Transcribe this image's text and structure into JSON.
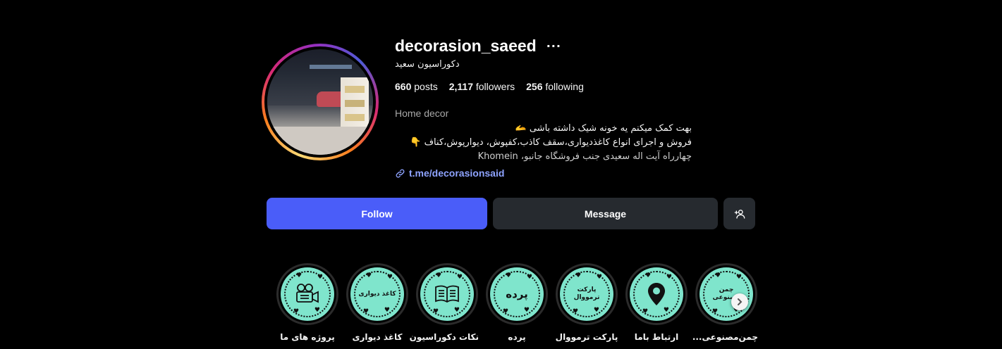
{
  "profile": {
    "username": "decorasion_saeed",
    "more_label": "···",
    "full_name": "دکوراسیون سعید",
    "stats": {
      "posts_count": "660",
      "posts_label": "posts",
      "followers_count": "2,117",
      "followers_label": "followers",
      "following_count": "256",
      "following_label": "following"
    },
    "category": "Home decor",
    "bio_line_1": "بهت کمک میکنم یه خونه شیک داشته باشی 🫴",
    "bio_line_2": "فروش و اجرای انواع کاغذدیواری،سقف کاذب،کفپوش، دیوارپوش،کناف 👇",
    "address": "چهارراه آیت اله سعیدی جنب فروشگاه جانبو، Khomein",
    "link": "t.me/decorasionsaid"
  },
  "actions": {
    "follow_label": "Follow",
    "message_label": "Message",
    "add_user_icon": "person-plus-icon"
  },
  "highlights": [
    {
      "label": "پروژه های ما",
      "cover_icon": "movie-camera-icon",
      "cover_text": ""
    },
    {
      "label": "کاغذ دیواری",
      "cover_icon": "",
      "cover_text": "کاغذ دیواری"
    },
    {
      "label": "نکات دکوراسیون",
      "cover_icon": "open-book-icon",
      "cover_text": ""
    },
    {
      "label": "پرده",
      "cover_icon": "",
      "cover_text": "پرده"
    },
    {
      "label": "پارکت ترمووال",
      "cover_icon": "",
      "cover_text": "پارکت ترمووال"
    },
    {
      "label": "ارتباط باما",
      "cover_icon": "location-pin-icon",
      "cover_text": ""
    },
    {
      "label": "چمن‌مصنوعی...",
      "cover_icon": "",
      "cover_text": "چمن مصنوعی"
    }
  ],
  "colors": {
    "background": "#000000",
    "follow_button": "#4a5df9",
    "secondary_button": "#262a2f",
    "link": "#8ea3ff",
    "highlight_cover": "#7fe5cc"
  }
}
